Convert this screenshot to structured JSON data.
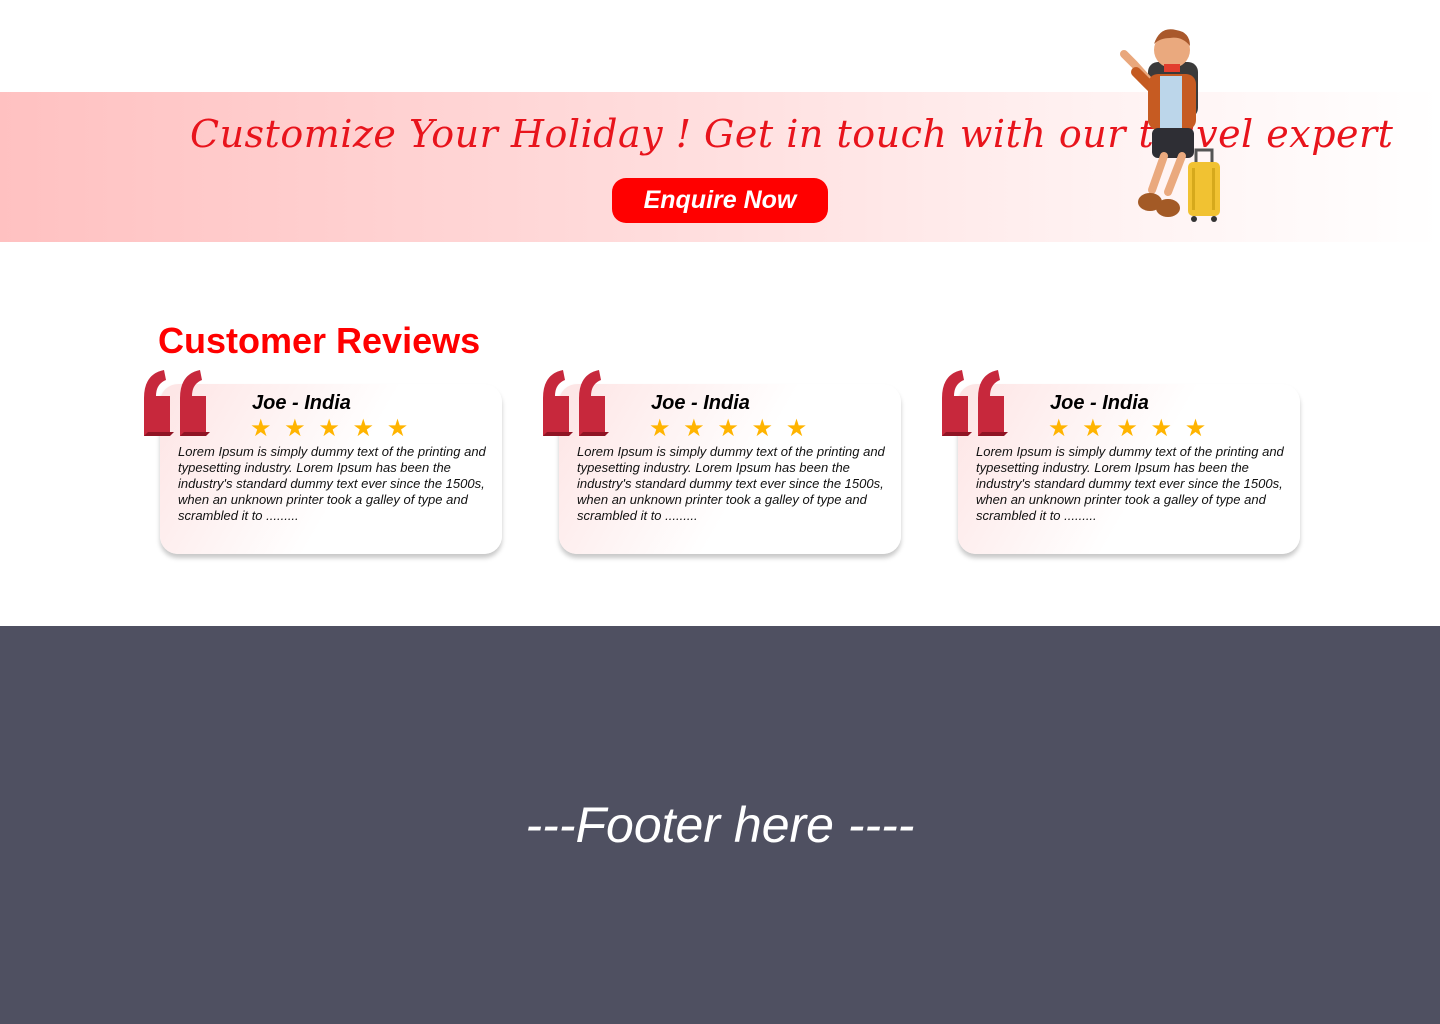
{
  "banner": {
    "title": "Customize Your Holiday ! Get in touch with our travel expert",
    "button_label": "Enquire Now",
    "accent_color": "#ff0000",
    "illustration": "traveler-with-suitcase"
  },
  "reviews": {
    "heading": "Customer Reviews",
    "items": [
      {
        "name": "Joe - India",
        "stars": "★ ★ ★ ★ ★",
        "rating": 5,
        "text": "Lorem Ipsum is simply dummy text of the printing and typesetting industry. Lorem Ipsum has been the industry's standard dummy text ever since the 1500s, when an unknown printer took a galley of type and scrambled it to ........."
      },
      {
        "name": "Joe - India",
        "stars": "★ ★ ★ ★ ★",
        "rating": 5,
        "text": "Lorem Ipsum is simply dummy text of the printing and typesetting industry. Lorem Ipsum has been the industry's standard dummy text ever since the 1500s, when an unknown printer took a galley of type and scrambled it to ........."
      },
      {
        "name": "Joe - India",
        "stars": "★ ★ ★ ★ ★",
        "rating": 5,
        "text": "Lorem Ipsum is simply dummy text of the printing and typesetting industry. Lorem Ipsum has been the industry's standard dummy text ever since the 1500s, when an unknown printer took a galley of type and scrambled it to ........."
      }
    ],
    "quote_icon": "quote-mark-icon",
    "star_color": "#ffb400"
  },
  "footer": {
    "text": "---Footer here ----",
    "background": "#4f5061"
  }
}
